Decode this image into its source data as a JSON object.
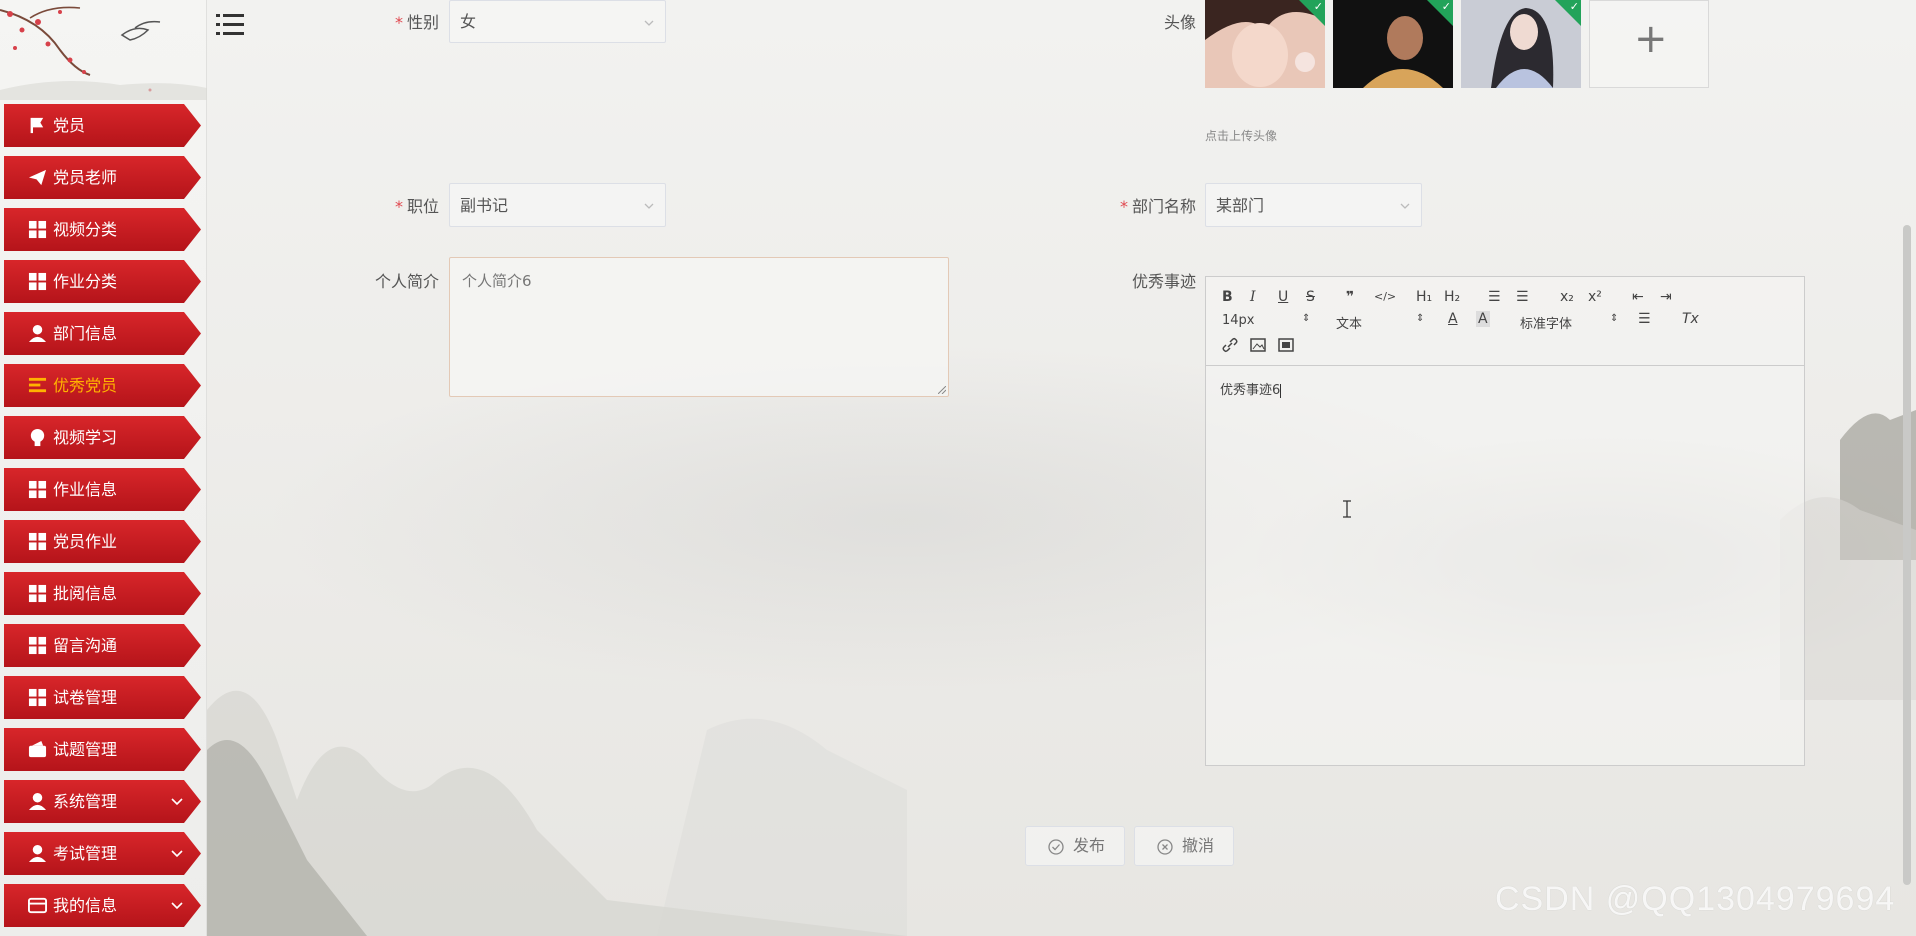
{
  "sidebar": {
    "items": [
      {
        "label": "党员",
        "icon": "flag-icon"
      },
      {
        "label": "党员老师",
        "icon": "paper-plane-icon"
      },
      {
        "label": "视频分类",
        "icon": "grid-icon"
      },
      {
        "label": "作业分类",
        "icon": "grid-icon"
      },
      {
        "label": "部门信息",
        "icon": "user-icon"
      },
      {
        "label": "优秀党员",
        "icon": "list-icon",
        "active": true
      },
      {
        "label": "视频学习",
        "icon": "bulb-icon"
      },
      {
        "label": "作业信息",
        "icon": "grid-icon"
      },
      {
        "label": "党员作业",
        "icon": "grid-icon"
      },
      {
        "label": "批阅信息",
        "icon": "grid-icon"
      },
      {
        "label": "留言沟通",
        "icon": "grid-icon"
      },
      {
        "label": "试卷管理",
        "icon": "grid-icon"
      },
      {
        "label": "试题管理",
        "icon": "wallet-icon"
      },
      {
        "label": "系统管理",
        "icon": "person-icon",
        "expandable": true
      },
      {
        "label": "考试管理",
        "icon": "person-icon",
        "expandable": true
      },
      {
        "label": "我的信息",
        "icon": "card-icon",
        "expandable": true
      }
    ],
    "active_color": "#ffb300",
    "item_color": "#c61d22"
  },
  "form": {
    "gender": {
      "label": "性别",
      "value": "女",
      "required": true
    },
    "avatar": {
      "label": "头像",
      "hint": "点击上传头像",
      "upload_symbol": "+"
    },
    "position": {
      "label": "职位",
      "value": "副书记",
      "required": true
    },
    "department": {
      "label": "部门名称",
      "value": "某部门",
      "required": true
    },
    "intro": {
      "label": "个人简介",
      "value": "个人简介6"
    },
    "deeds": {
      "label": "优秀事迹",
      "content": "优秀事迹6",
      "toolbar": {
        "bold": "B",
        "italic": "I",
        "underline": "U",
        "strike": "S",
        "quote": "❞",
        "code": "</>",
        "h1": "H₁",
        "h2": "H₂",
        "ordered": "☰",
        "bullet": "☰",
        "sub": "x₂",
        "sup": "x²",
        "outdent": "⇤",
        "indent": "⇥",
        "size": "14px",
        "header": "文本",
        "font": "标准字体",
        "color": "A",
        "background": "A",
        "align": "☰",
        "clean": "Tx"
      }
    },
    "submit": "发布",
    "cancel": "撤消"
  },
  "watermark": "CSDN @QQ1304979694"
}
